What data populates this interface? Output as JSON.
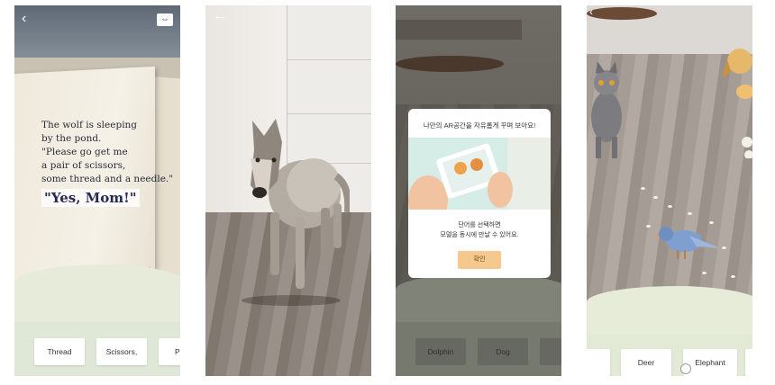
{
  "screen1": {
    "story_lines": [
      "The wolf is sleeping",
      "by the pond.",
      "\"Please go get me",
      "a pair of scissors,",
      "some thread and a needle.\""
    ],
    "highlight": "\"Yes, Mom!\"",
    "words": [
      "Thread",
      "Scissors,",
      "P"
    ],
    "back_icon": "‹",
    "switch_icon": "⇔"
  },
  "screen2": {
    "back_icon": "←"
  },
  "screen3": {
    "dialog_title": "나만의 AR공간을 자유롭게 꾸며 보아요!",
    "dialog_message_1": "단어를 선택하면",
    "dialog_message_2": "모델을 동시에 만날 수 있어요.",
    "confirm_label": "확인",
    "words": [
      "Dolphin",
      "Dog"
    ]
  },
  "screen4": {
    "words": [
      "Deer",
      "Elephant"
    ]
  }
}
